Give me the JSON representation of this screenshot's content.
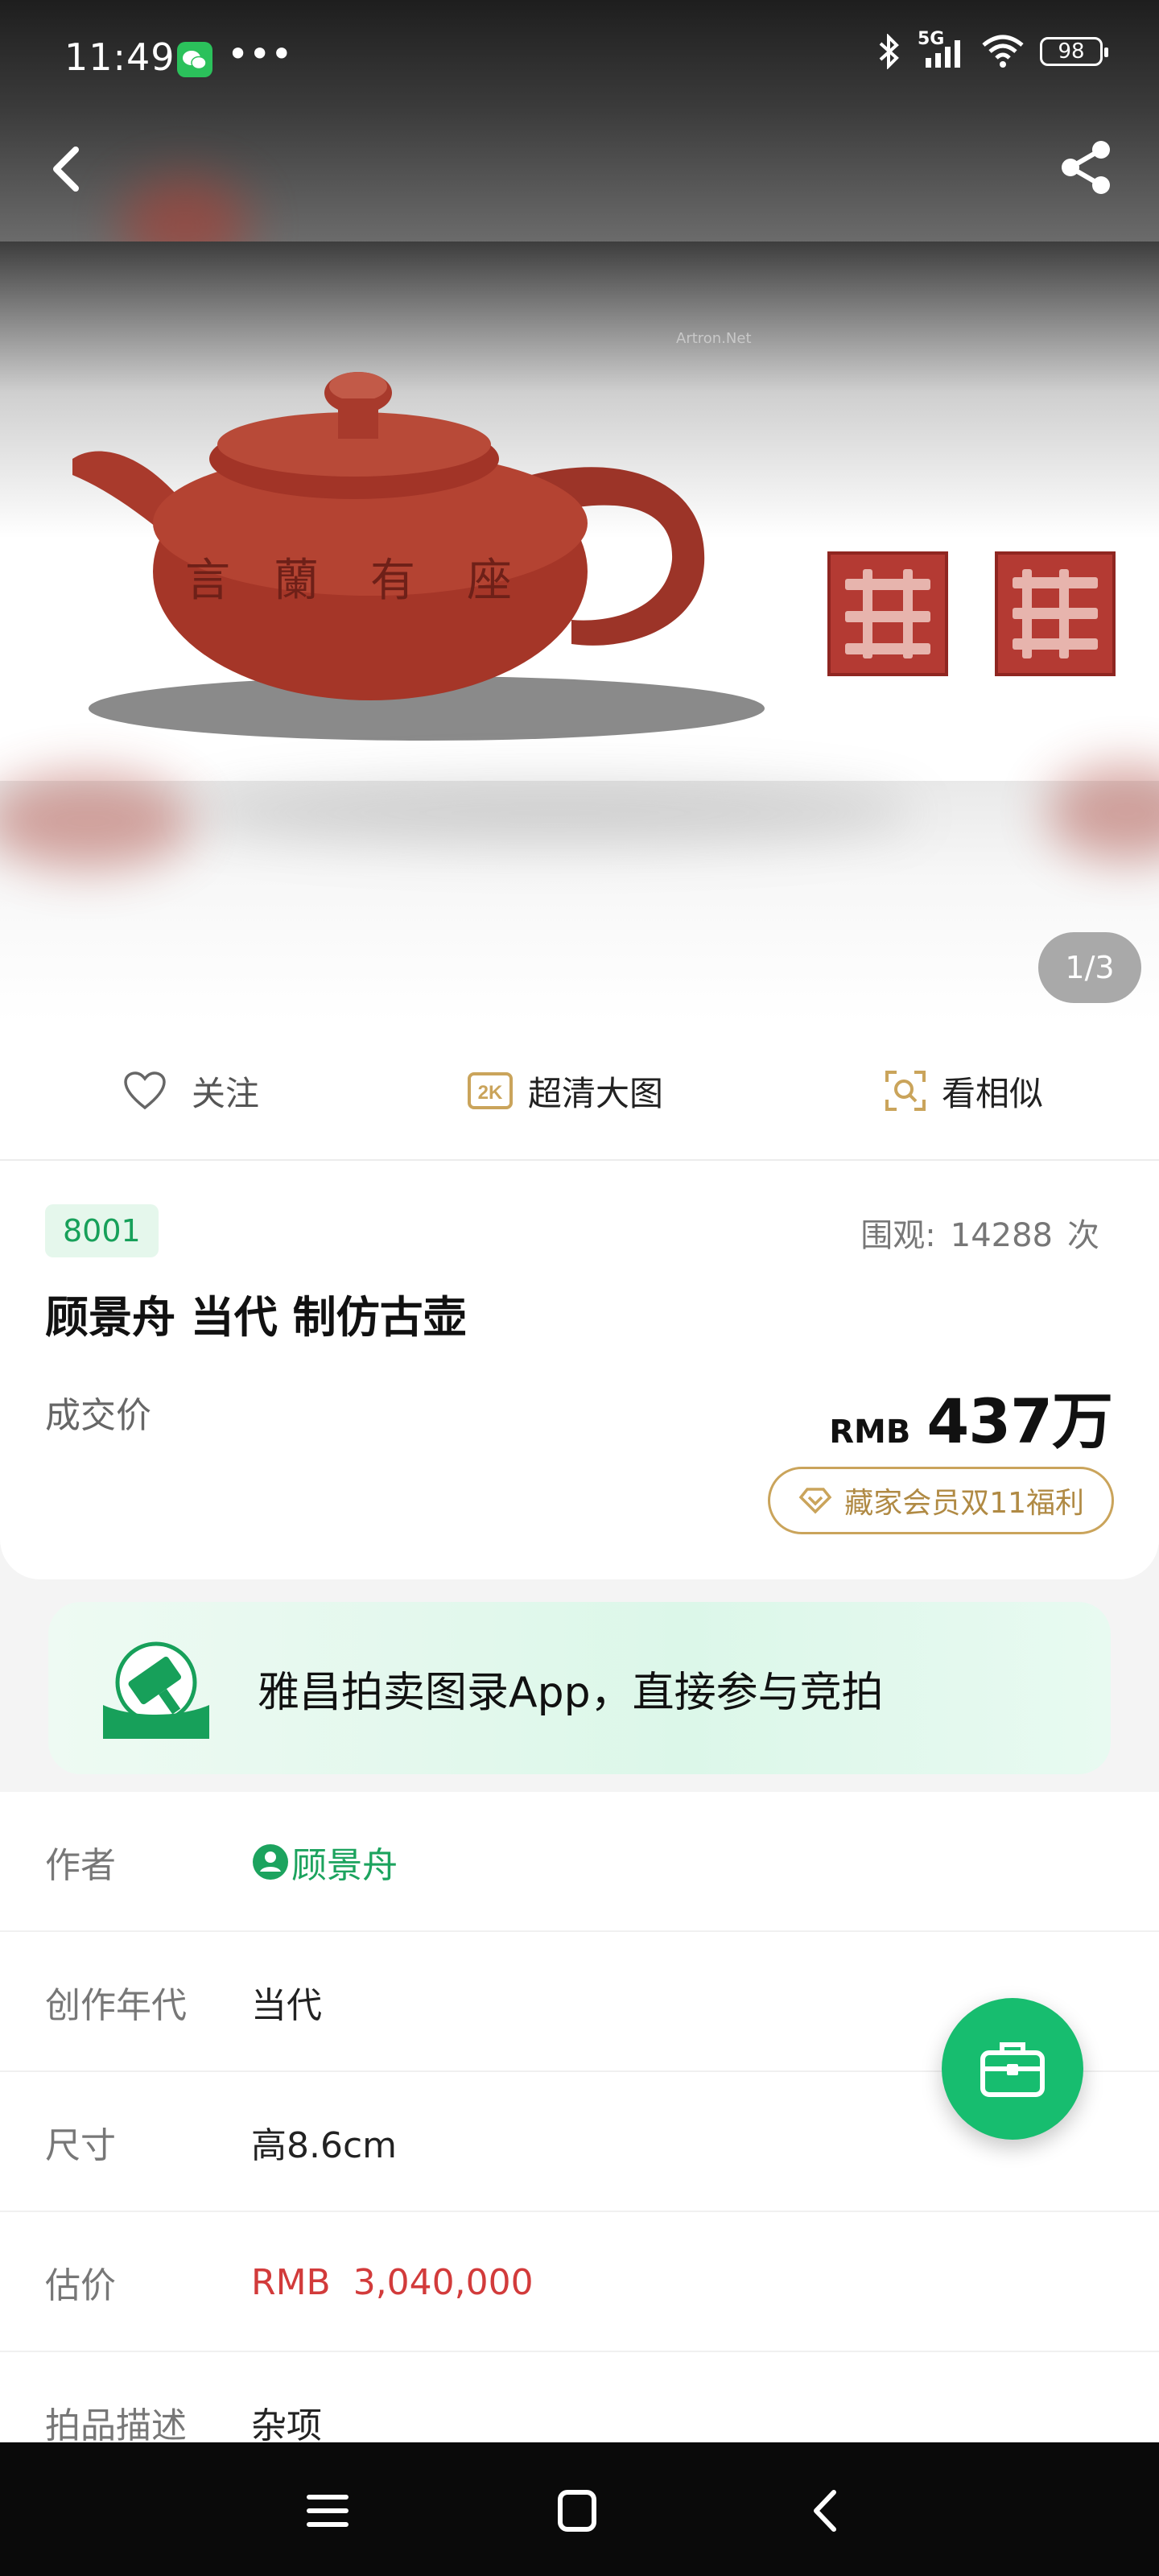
{
  "status_bar": {
    "time": "11:49",
    "network": "5G",
    "wifi_level": "6",
    "battery": "98"
  },
  "gallery": {
    "watermark": "Artron.Net",
    "counter": "1/3"
  },
  "actions": {
    "follow": "关注",
    "hd_badge": "2K",
    "hd": "超清大图",
    "similar": "看相似"
  },
  "lot": {
    "number": "8001",
    "views_label": "围观:",
    "views_count": "14288",
    "views_unit": "次",
    "title": "顾景舟 当代 制仿古壶",
    "deal_label": "成交价",
    "currency": "RMB",
    "price": "437万",
    "vip_offer": "藏家会员双11福利"
  },
  "banner": {
    "text": "雅昌拍卖图录App，直接参与竞拍"
  },
  "details": [
    {
      "key": "作者",
      "value": "顾景舟"
    },
    {
      "key": "创作年代",
      "value": "当代"
    },
    {
      "key": "尺寸",
      "value": "高8.6cm"
    },
    {
      "key": "估价",
      "value": "RMB  3,040,000"
    },
    {
      "key": "拍品描述",
      "value": "杂项"
    }
  ],
  "colors": {
    "accent_green": "#17bd6f",
    "price_red": "#d23b3b",
    "gold": "#caa45b"
  }
}
